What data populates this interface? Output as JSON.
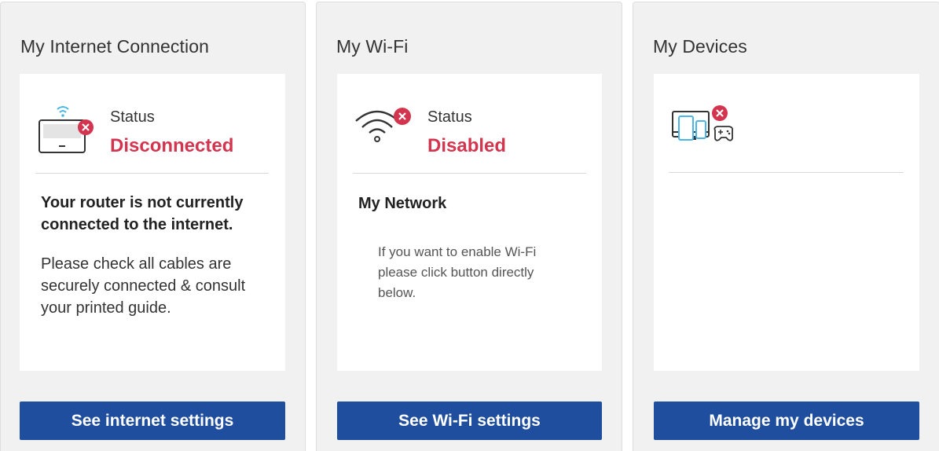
{
  "cards": {
    "internet": {
      "title": "My Internet Connection",
      "status_label": "Status",
      "status_value": "Disconnected",
      "headline": "Your router is not currently connected to the internet.",
      "body": "Please check all cables are securely connected & consult your printed guide.",
      "button": "See internet settings",
      "icon": "router-disconnected-icon"
    },
    "wifi": {
      "title": "My Wi-Fi",
      "status_label": "Status",
      "status_value": "Disabled",
      "network_title": "My Network",
      "network_desc": "If you want to enable Wi-Fi please click button directly below.",
      "button": "See Wi-Fi settings",
      "icon": "wifi-disabled-icon"
    },
    "devices": {
      "title": "My Devices",
      "button": "Manage my devices",
      "icon": "devices-disconnected-icon"
    }
  },
  "colors": {
    "card_background": "#f1f1f1",
    "status_error": "#d3344e",
    "button_blue": "#1f4e9f",
    "icon_accent": "#4ab6e8"
  }
}
